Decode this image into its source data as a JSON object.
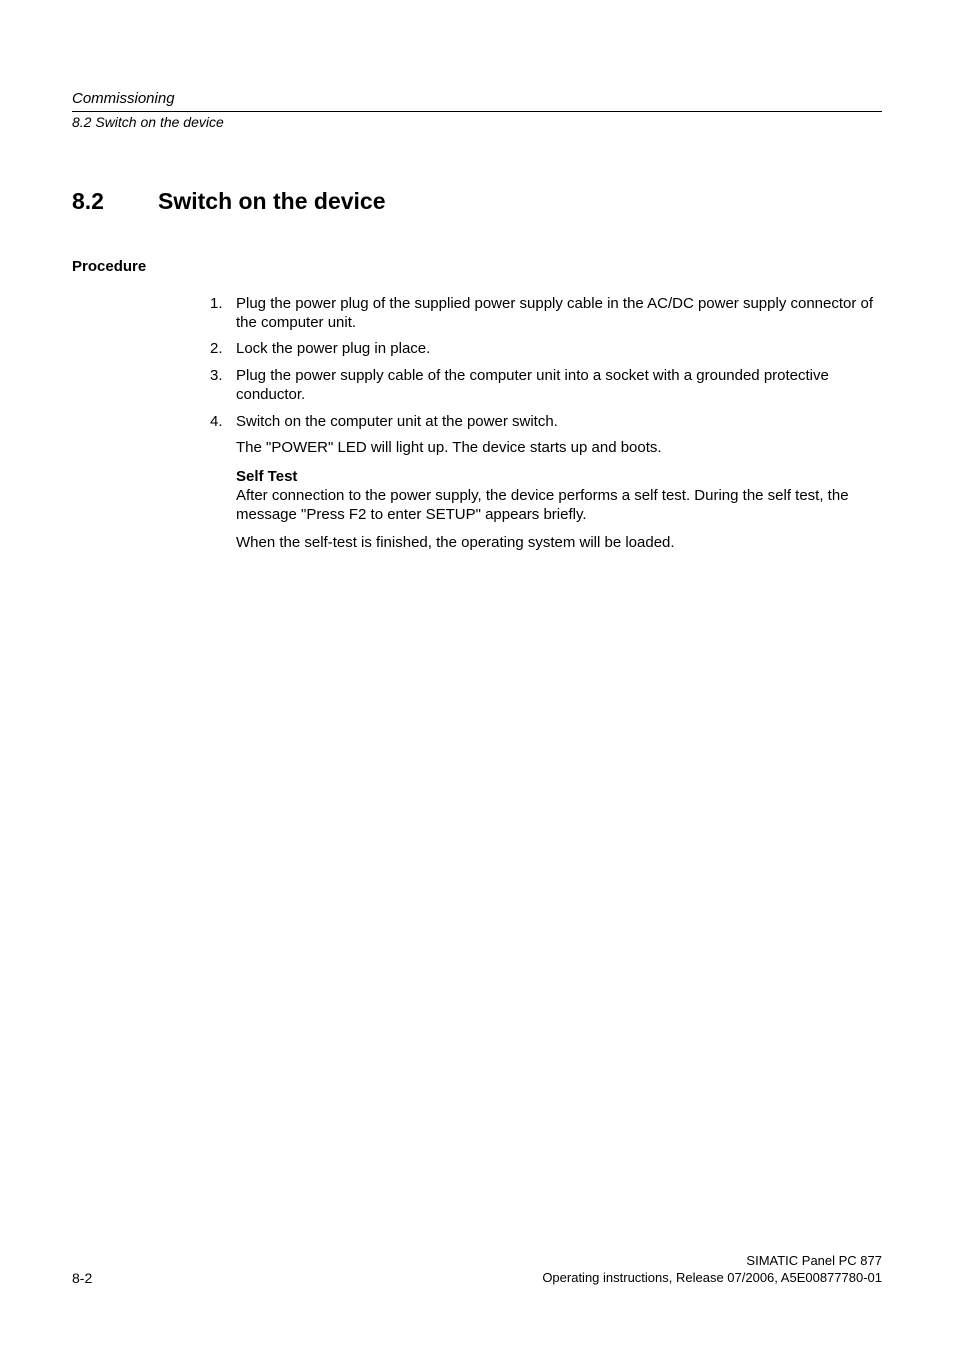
{
  "header": {
    "chapter": "Commissioning",
    "section_ref": "8.2 Switch on the device"
  },
  "section": {
    "number": "8.2",
    "title": "Switch on the device"
  },
  "procedure": {
    "label": "Procedure",
    "steps": [
      "Plug the power plug of the supplied power supply cable in the AC/DC power supply connector of the computer unit.",
      "Lock the power plug in place.",
      "Plug the power supply cable of the computer unit into a socket with a grounded protective conductor.",
      "Switch on the computer unit at the power switch."
    ],
    "after_step4_line": "The \"POWER\" LED will light up. The device starts up and boots.",
    "selftest_title": "Self Test",
    "selftest_text": "After connection to the power supply, the device performs a self test. During the self test, the message \"Press F2 to enter SETUP\" appears briefly.",
    "selftest_closing": "When the self-test is finished, the operating system will be loaded."
  },
  "footer": {
    "page_label": "8-2",
    "product": "SIMATIC Panel PC 877",
    "doc_ref": "Operating instructions, Release 07/2006, A5E00877780-01"
  }
}
